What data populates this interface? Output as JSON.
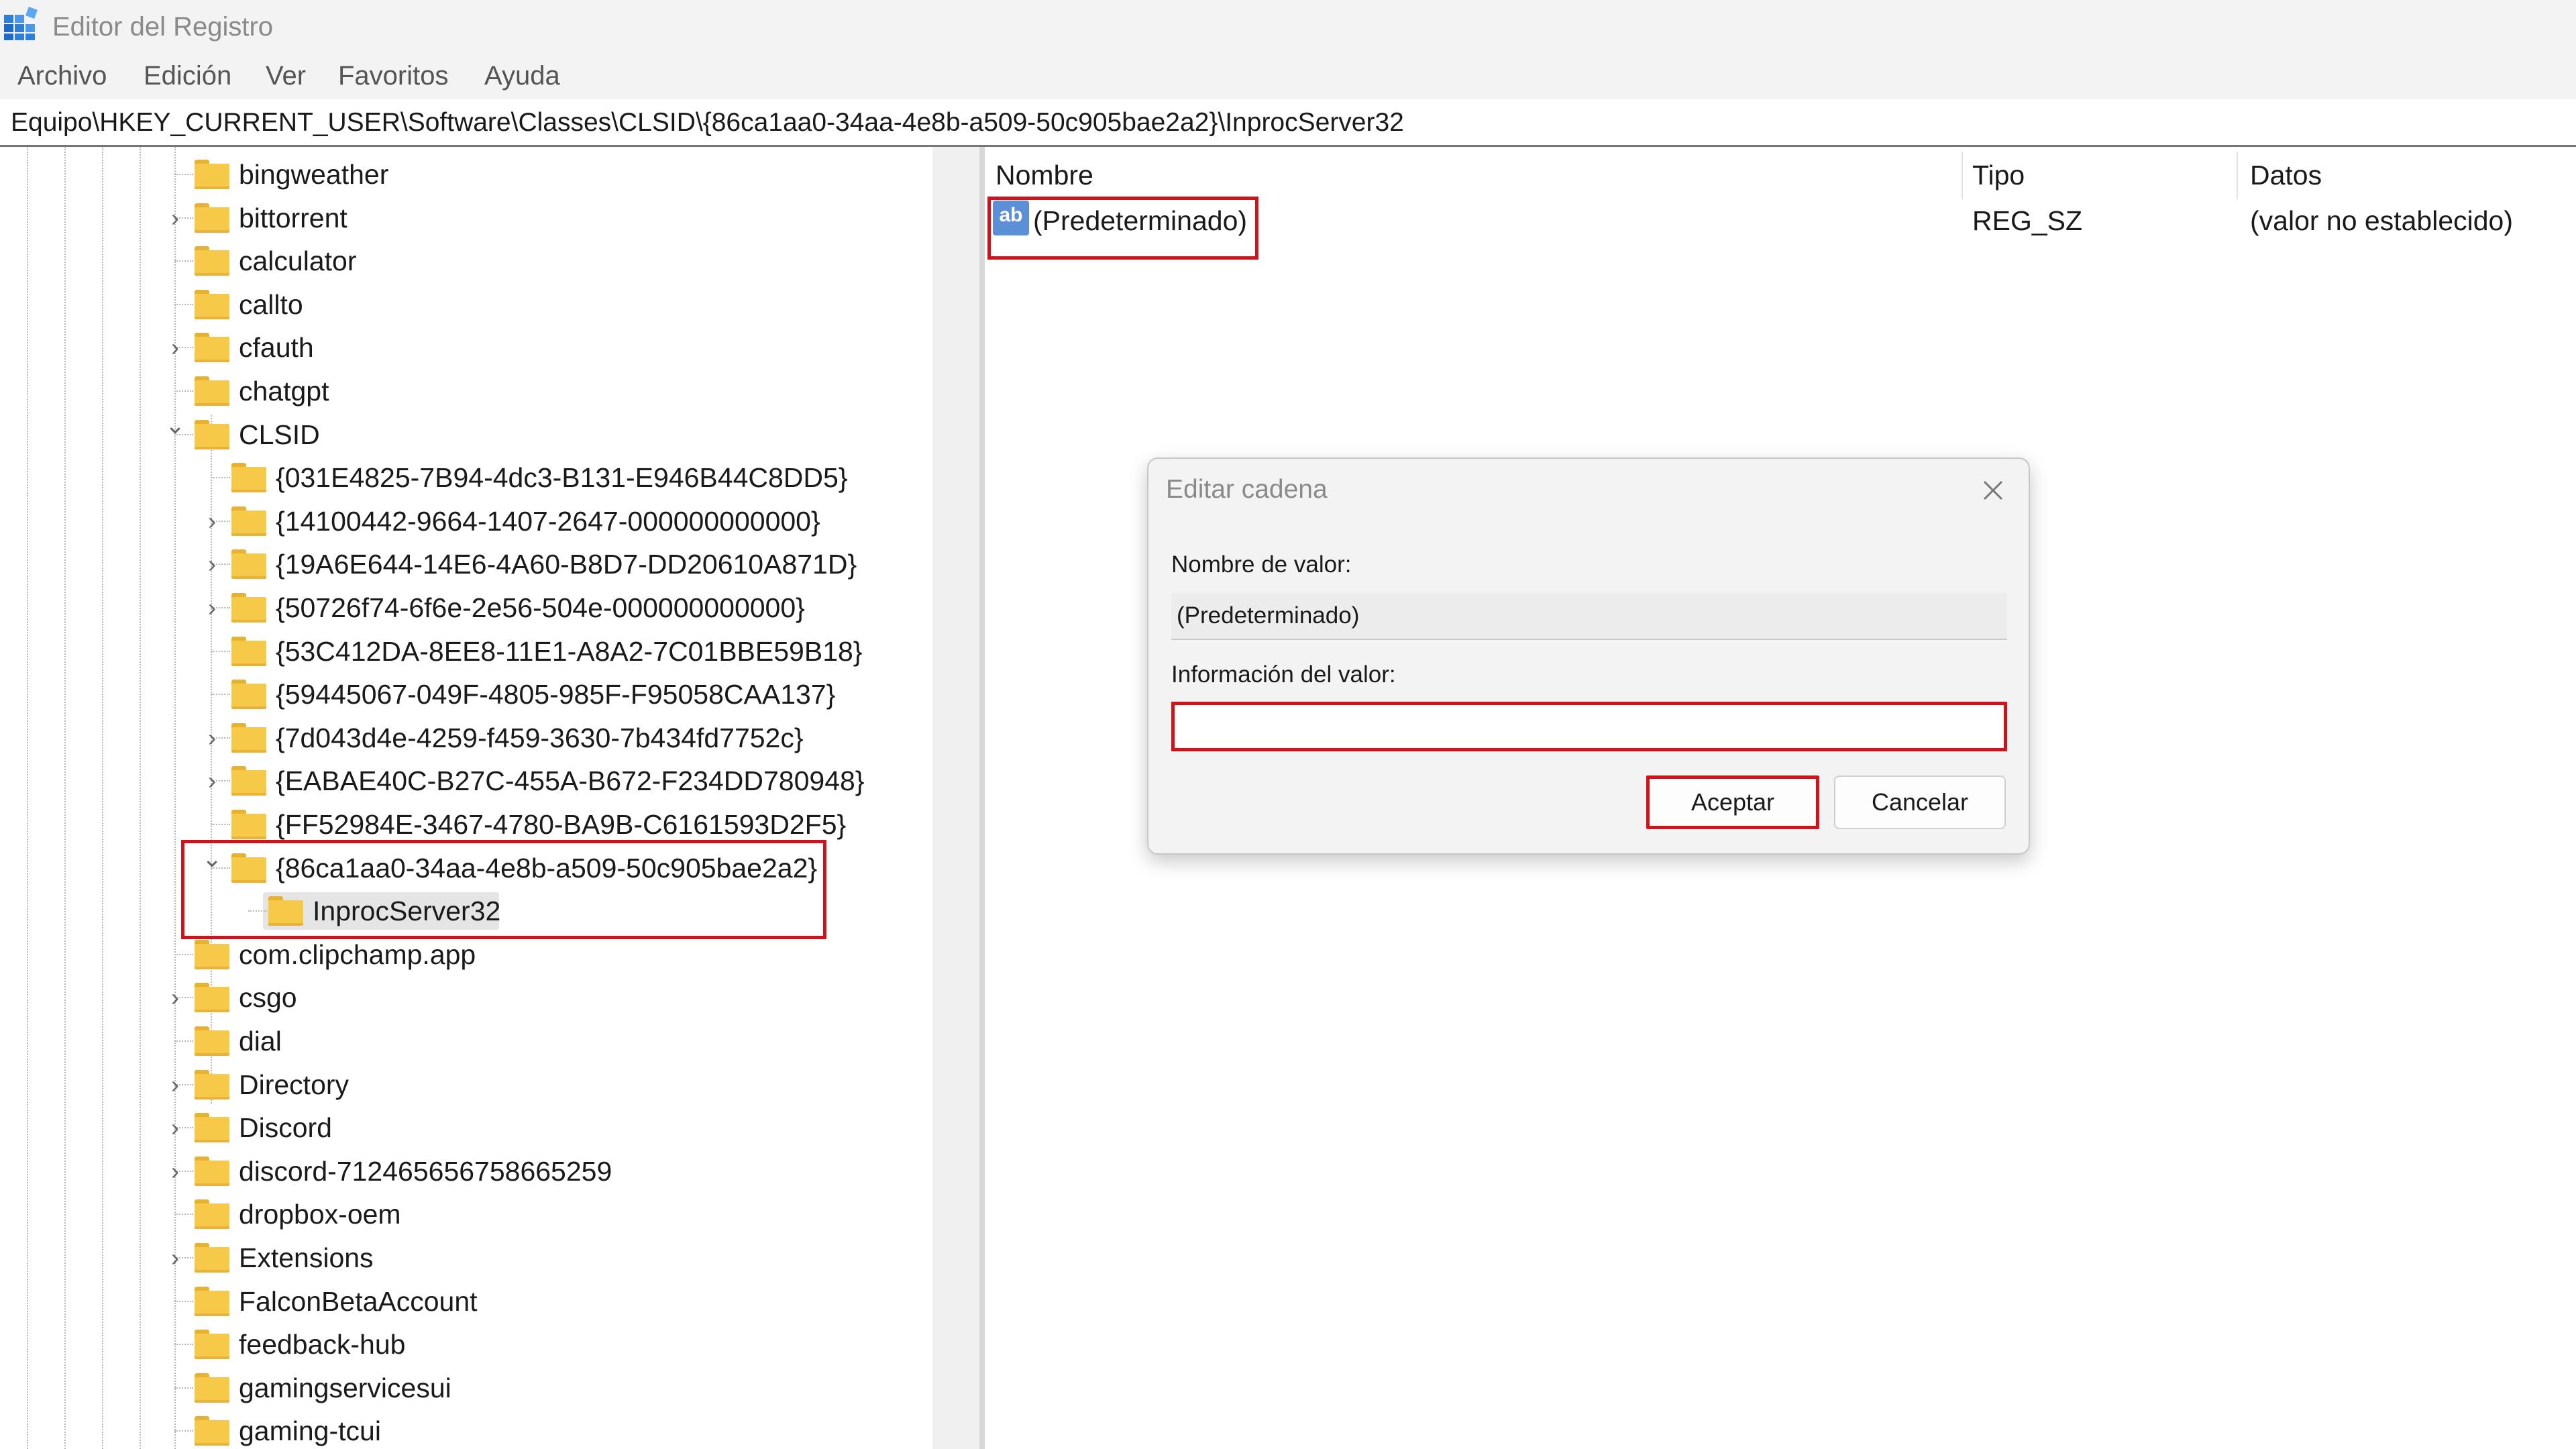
{
  "window": {
    "title": "Editor del Registro"
  },
  "menu": [
    "Archivo",
    "Edición",
    "Ver",
    "Favoritos",
    "Ayuda"
  ],
  "address": "Equipo\\HKEY_CURRENT_USER\\Software\\Classes\\CLSID\\{86ca1aa0-34aa-4e8b-a509-50c905bae2a2}\\InprocServer32",
  "tree": {
    "items": [
      "bingweather",
      "bittorrent",
      "calculator",
      "callto",
      "cfauth",
      "chatgpt",
      "CLSID",
      "{031E4825-7B94-4dc3-B131-E946B44C8DD5}",
      "{14100442-9664-1407-2647-000000000000}",
      "{19A6E644-14E6-4A60-B8D7-DD20610A871D}",
      "{50726f74-6f6e-2e56-504e-000000000000}",
      "{53C412DA-8EE8-11E1-A8A2-7C01BBE59B18}",
      "{59445067-049F-4805-985F-F95058CAA137}",
      "{7d043d4e-4259-f459-3630-7b434fd7752c}",
      "{EABAE40C-B27C-455A-B672-F234DD780948}",
      "{FF52984E-3467-4780-BA9B-C6161593D2F5}",
      "{86ca1aa0-34aa-4e8b-a509-50c905bae2a2}",
      "InprocServer32",
      "com.clipchamp.app",
      "csgo",
      "dial",
      "Directory",
      "Discord",
      "discord-712465656758665259",
      "dropbox-oem",
      "Extensions",
      "FalconBetaAccount",
      "feedback-hub",
      "gamingservicesui",
      "gaming-tcui"
    ]
  },
  "list": {
    "columns": {
      "name": "Nombre",
      "type": "Tipo",
      "data": "Datos"
    },
    "rows": [
      {
        "name": "(Predeterminado)",
        "type": "REG_SZ",
        "data": "(valor no establecido)",
        "icon": "string-value-icon"
      }
    ]
  },
  "dialog": {
    "title": "Editar cadena",
    "value_name_label": "Nombre de valor:",
    "value_name": "(Predeterminado)",
    "value_data_label": "Información del valor:",
    "value_data": "",
    "ok_label": "Aceptar",
    "cancel_label": "Cancelar"
  },
  "colors": {
    "highlight": "#d0121b",
    "folder": "#f7c948",
    "selection": "#e5e5e5"
  }
}
